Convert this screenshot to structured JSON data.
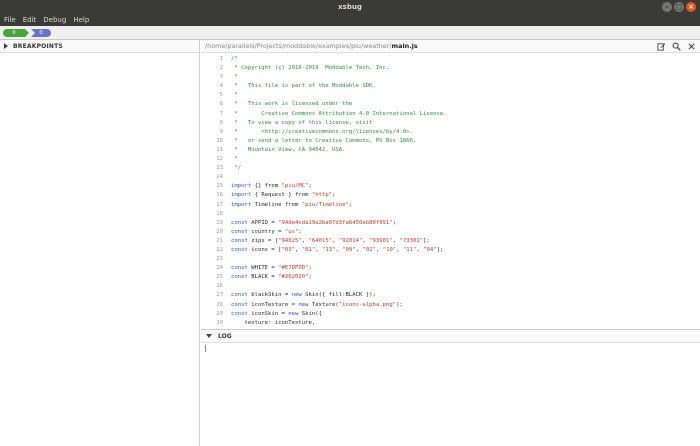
{
  "window": {
    "title": "xsbug",
    "controls": {
      "minimize": "–",
      "maximize": "□",
      "close": "×"
    }
  },
  "menu": [
    "File",
    "Edit",
    "Debug",
    "Help"
  ],
  "machine_tabs": [
    {
      "label": "0",
      "color": "#47a53a"
    },
    {
      "label": "0",
      "color": "#6a72c9"
    }
  ],
  "breakpoints": {
    "label": "BREAKPOINTS"
  },
  "editor": {
    "path_dir": "/home/parallels/Projects/moddable/examples/piu/weather/",
    "path_file": "main.js",
    "icons": [
      "edit-icon",
      "search-icon",
      "close-icon"
    ],
    "lines": [
      {
        "n": "1",
        "tokens": [
          {
            "t": "/*",
            "c": "comment"
          }
        ]
      },
      {
        "n": "2",
        "tokens": [
          {
            "t": " * Copyright (c) 2016-2019  Moddable Tech, Inc.",
            "c": "comment"
          }
        ]
      },
      {
        "n": "3",
        "tokens": [
          {
            "t": " *",
            "c": "comment"
          }
        ]
      },
      {
        "n": "4",
        "tokens": [
          {
            "t": " *   This file is part of the Moddable SDK.",
            "c": "comment"
          }
        ]
      },
      {
        "n": "5",
        "tokens": [
          {
            "t": " *",
            "c": "comment"
          }
        ]
      },
      {
        "n": "6",
        "tokens": [
          {
            "t": " *   This work is licensed under the",
            "c": "comment"
          }
        ]
      },
      {
        "n": "7",
        "tokens": [
          {
            "t": " *       Creative Commons Attribution 4.0 International License.",
            "c": "comment"
          }
        ]
      },
      {
        "n": "8",
        "tokens": [
          {
            "t": " *   To view a copy of this license, visit",
            "c": "comment"
          }
        ]
      },
      {
        "n": "9",
        "tokens": [
          {
            "t": " *       <http://creativecommons.org/licenses/by/4.0>.",
            "c": "comment"
          }
        ]
      },
      {
        "n": "10",
        "tokens": [
          {
            "t": " *   or send a letter to Creative Commons, PO Box 1866,",
            "c": "comment"
          }
        ]
      },
      {
        "n": "11",
        "tokens": [
          {
            "t": " *   Mountain View, CA 94042, USA.",
            "c": "comment"
          }
        ]
      },
      {
        "n": "12",
        "tokens": [
          {
            "t": " *",
            "c": "comment"
          }
        ]
      },
      {
        "n": "13",
        "tokens": [
          {
            "t": " */",
            "c": "comment"
          }
        ]
      },
      {
        "n": "14",
        "tokens": []
      },
      {
        "n": "15",
        "tokens": [
          {
            "t": "import",
            "c": "kw"
          },
          {
            "t": " {} from ",
            "c": "plain"
          },
          {
            "t": "\"piu/MC\"",
            "c": "str"
          },
          {
            "t": ";",
            "c": "plain"
          }
        ]
      },
      {
        "n": "16",
        "tokens": [
          {
            "t": "import",
            "c": "kw"
          },
          {
            "t": " { Request } from ",
            "c": "plain"
          },
          {
            "t": "\"http\"",
            "c": "str"
          },
          {
            "t": ";",
            "c": "plain"
          }
        ]
      },
      {
        "n": "17",
        "tokens": [
          {
            "t": "import",
            "c": "kw"
          },
          {
            "t": " Timeline from ",
            "c": "plain"
          },
          {
            "t": "\"piu/Timeline\"",
            "c": "str"
          },
          {
            "t": ";",
            "c": "plain"
          }
        ]
      },
      {
        "n": "18",
        "tokens": []
      },
      {
        "n": "19",
        "tokens": [
          {
            "t": "const",
            "c": "kw"
          },
          {
            "t": " APPID = ",
            "c": "plain"
          },
          {
            "t": "\"94de4cda19a2ba07d3fa6450eb80f091\"",
            "c": "str"
          },
          {
            "t": ";",
            "c": "plain"
          }
        ]
      },
      {
        "n": "20",
        "tokens": [
          {
            "t": "const",
            "c": "kw"
          },
          {
            "t": " country = ",
            "c": "plain"
          },
          {
            "t": "\"us\"",
            "c": "str"
          },
          {
            "t": ";",
            "c": "plain"
          }
        ]
      },
      {
        "n": "21",
        "tokens": [
          {
            "t": "const",
            "c": "kw"
          },
          {
            "t": " zips = [",
            "c": "plain"
          },
          {
            "t": "\"94025\"",
            "c": "str"
          },
          {
            "t": ", ",
            "c": "plain"
          },
          {
            "t": "\"64015\"",
            "c": "str"
          },
          {
            "t": ", ",
            "c": "plain"
          },
          {
            "t": "\"92014\"",
            "c": "str"
          },
          {
            "t": ", ",
            "c": "plain"
          },
          {
            "t": "\"93901\"",
            "c": "str"
          },
          {
            "t": ", ",
            "c": "plain"
          },
          {
            "t": "\"73301\"",
            "c": "str"
          },
          {
            "t": "];",
            "c": "plain"
          }
        ]
      },
      {
        "n": "22",
        "tokens": [
          {
            "t": "const",
            "c": "kw"
          },
          {
            "t": " icons = [",
            "c": "plain"
          },
          {
            "t": "\"03\"",
            "c": "str"
          },
          {
            "t": ", ",
            "c": "plain"
          },
          {
            "t": "\"01\"",
            "c": "str"
          },
          {
            "t": ", ",
            "c": "plain"
          },
          {
            "t": "\"13\"",
            "c": "str"
          },
          {
            "t": ", ",
            "c": "plain"
          },
          {
            "t": "\"09\"",
            "c": "str"
          },
          {
            "t": ", ",
            "c": "plain"
          },
          {
            "t": "\"02\"",
            "c": "str"
          },
          {
            "t": ", ",
            "c": "plain"
          },
          {
            "t": "\"10\"",
            "c": "str"
          },
          {
            "t": ", ",
            "c": "plain"
          },
          {
            "t": "\"11\"",
            "c": "str"
          },
          {
            "t": ", ",
            "c": "plain"
          },
          {
            "t": "\"04\"",
            "c": "str"
          },
          {
            "t": "];",
            "c": "plain"
          }
        ]
      },
      {
        "n": "23",
        "tokens": []
      },
      {
        "n": "24",
        "tokens": [
          {
            "t": "const",
            "c": "kw"
          },
          {
            "t": " WHITE = ",
            "c": "plain"
          },
          {
            "t": "\"#E7DFDD\"",
            "c": "str"
          },
          {
            "t": ";",
            "c": "plain"
          }
        ]
      },
      {
        "n": "25",
        "tokens": [
          {
            "t": "const",
            "c": "kw"
          },
          {
            "t": " BLACK = ",
            "c": "plain"
          },
          {
            "t": "\"#202020\"",
            "c": "str"
          },
          {
            "t": ";",
            "c": "plain"
          }
        ]
      },
      {
        "n": "26",
        "tokens": []
      },
      {
        "n": "27",
        "tokens": [
          {
            "t": "const",
            "c": "kw"
          },
          {
            "t": " blackSkin = ",
            "c": "plain"
          },
          {
            "t": "new",
            "c": "kw"
          },
          {
            "t": " Skin({ fill:BLACK });",
            "c": "plain"
          }
        ]
      },
      {
        "n": "28",
        "tokens": [
          {
            "t": "const",
            "c": "kw"
          },
          {
            "t": " iconTexture = ",
            "c": "plain"
          },
          {
            "t": "new",
            "c": "kw"
          },
          {
            "t": " Texture(",
            "c": "plain"
          },
          {
            "t": "\"icons-alpha.png\"",
            "c": "str"
          },
          {
            "t": ");",
            "c": "plain"
          }
        ]
      },
      {
        "n": "29",
        "tokens": [
          {
            "t": "const",
            "c": "kw"
          },
          {
            "t": " iconSkin = ",
            "c": "plain"
          },
          {
            "t": "new",
            "c": "kw"
          },
          {
            "t": " Skin({",
            "c": "plain"
          }
        ]
      },
      {
        "n": "30",
        "tokens": [
          {
            "t": "    texture: iconTexture,",
            "c": "plain"
          }
        ]
      }
    ]
  },
  "log": {
    "label": "LOG"
  }
}
